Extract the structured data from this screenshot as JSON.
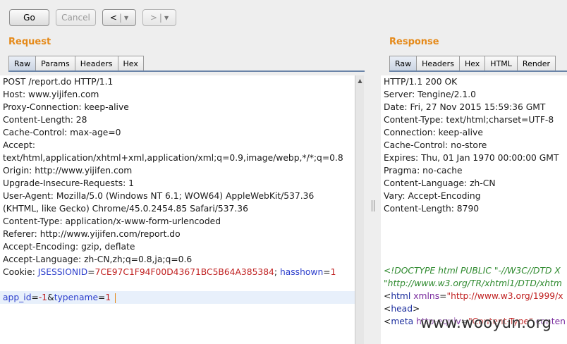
{
  "toolbar": {
    "go_label": "Go",
    "cancel_label": "Cancel",
    "back_label": "<",
    "forward_label": ">",
    "dropdown_glyph": "▼"
  },
  "request": {
    "title": "Request",
    "tabs": [
      "Raw",
      "Params",
      "Headers",
      "Hex"
    ],
    "lines": [
      "POST /report.do HTTP/1.1",
      "Host: www.yijifen.com",
      "Proxy-Connection: keep-alive",
      "Content-Length: 28",
      "Cache-Control: max-age=0",
      "Accept:",
      "text/html,application/xhtml+xml,application/xml;q=0.9,image/webp,*/*;q=0.8",
      "Origin: http://www.yijifen.com",
      "Upgrade-Insecure-Requests: 1",
      "User-Agent: Mozilla/5.0 (Windows NT 6.1; WOW64) AppleWebKit/537.36",
      "(KHTML, like Gecko) Chrome/45.0.2454.85 Safari/537.36",
      "Content-Type: application/x-www-form-urlencoded",
      "Referer: http://www.yijifen.com/report.do",
      "Accept-Encoding: gzip, deflate",
      "Accept-Language: zh-CN,zh;q=0.8,ja;q=0.6"
    ],
    "cookie": {
      "prefix": "Cookie: ",
      "k1": "JSESSIONID",
      "eq": "=",
      "v1": "7CE97C1F94F00D43671BC5B64A385384",
      "sep": "; ",
      "k2": "hasshown",
      "v2": "1"
    },
    "body": {
      "k1": "app_id",
      "eq": "=",
      "v1": "-1",
      "amp": "&",
      "k2": "typename",
      "v2": "1"
    }
  },
  "response": {
    "title": "Response",
    "tabs": [
      "Raw",
      "Headers",
      "Hex",
      "HTML",
      "Render"
    ],
    "lines": [
      "HTTP/1.1 200 OK",
      "Server: Tengine/2.1.0",
      "Date: Fri, 27 Nov 2015 15:59:36 GMT",
      "Content-Type: text/html;charset=UTF-8",
      "Connection: keep-alive",
      "Cache-Control: no-store",
      "Expires: Thu, 01 Jan 1970 00:00:00 GMT",
      "Pragma: no-cache",
      "Content-Language: zh-CN",
      "Vary: Accept-Encoding",
      "Content-Length: 8790"
    ],
    "html_lines": {
      "doctype1": "<!DOCTYPE html PUBLIC \"-//W3C//DTD X",
      "doctype2": "\"http://www.w3.org/TR/xhtml1/DTD/xhtm",
      "html_open": "<",
      "html_tag": "html",
      "html_attr": " xmlns",
      "html_eq": "=",
      "html_val": "\"http://www.w3.org/1999/x",
      "head_lt": "<",
      "head_tag": "head",
      "head_gt": ">",
      "meta_lt": "<",
      "meta_tag": "meta",
      "meta_attr": " http-equiv",
      "meta_eq": "=",
      "meta_val": "\"Content-Type\"",
      "meta_rest": " conten"
    }
  },
  "watermark": "www.wooyun.org",
  "colors": {
    "section_title": "#e58a1a",
    "param_name": "#2c3ecc",
    "param_value": "#c02020"
  }
}
